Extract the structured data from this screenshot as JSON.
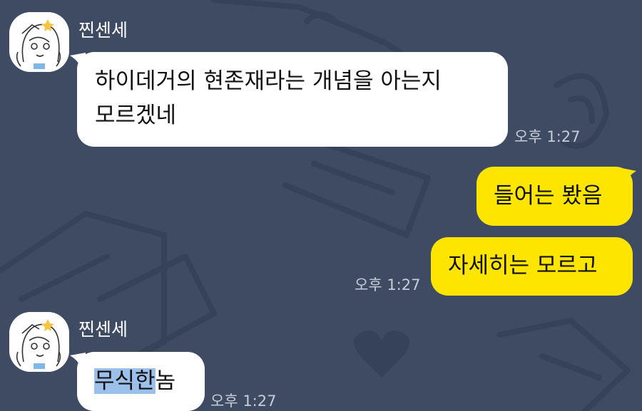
{
  "colors": {
    "background": "#3f4b63",
    "incoming_bubble": "#ffffff",
    "outgoing_bubble": "#fee500",
    "selection": "#9cc0ea"
  },
  "messages": [
    {
      "sender": "찐센세",
      "lines": [
        "하이데거의 현존재라는 개념을 아는지",
        "모르겠네"
      ],
      "time": "오후 1:27"
    },
    {
      "out1": "들어는 봤음",
      "out2": "자세히는 모르고",
      "time": "오후 1:27"
    },
    {
      "sender": "찐센세",
      "text_selected": "무식한",
      "text_rest": "놈",
      "time": "오후 1:27"
    }
  ],
  "icons": {
    "avatar": "anime-character-avatar-icon"
  }
}
